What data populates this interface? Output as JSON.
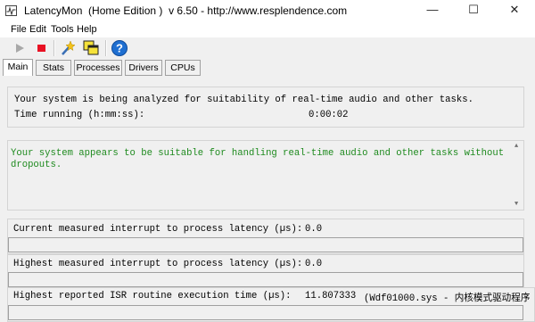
{
  "window": {
    "title": "LatencyMon  (Home Edition )  v 6.50 - http://www.resplendence.com",
    "minimize_glyph": "—",
    "maximize_glyph": "☐",
    "close_glyph": "✕"
  },
  "menu": [
    "File",
    "Edit",
    "Tools",
    "Help"
  ],
  "toolbar": {
    "icons": [
      "play-icon",
      "stop-icon",
      "wand-icon",
      "windows-icon",
      "help-icon"
    ]
  },
  "tabs": [
    "Main",
    "Stats",
    "Processes",
    "Drivers",
    "CPUs"
  ],
  "status_panel": {
    "line1": "Your system is being analyzed for suitability of real-time audio and other tasks.",
    "time_label": "Time running (h:mm:ss):",
    "time_value": "0:00:02"
  },
  "verdict_panel": {
    "line1": "Your system appears to be suitable for handling real-time audio and other tasks without",
    "line2": "dropouts."
  },
  "metrics": [
    {
      "label": "Current measured interrupt to process latency (µs):",
      "value": "0.0",
      "extra": ""
    },
    {
      "label": "Highest measured interrupt to process latency (µs):",
      "value": "0.0",
      "extra": ""
    },
    {
      "label": "Highest reported ISR routine execution time (µs):",
      "value": "11.807333",
      "extra": "(Wdf01000.sys - 内核模式驱动程序"
    }
  ],
  "colors": {
    "accent_green": "#1e8a1e",
    "stop_red": "#e81123",
    "help_blue": "#1f6fd1"
  }
}
